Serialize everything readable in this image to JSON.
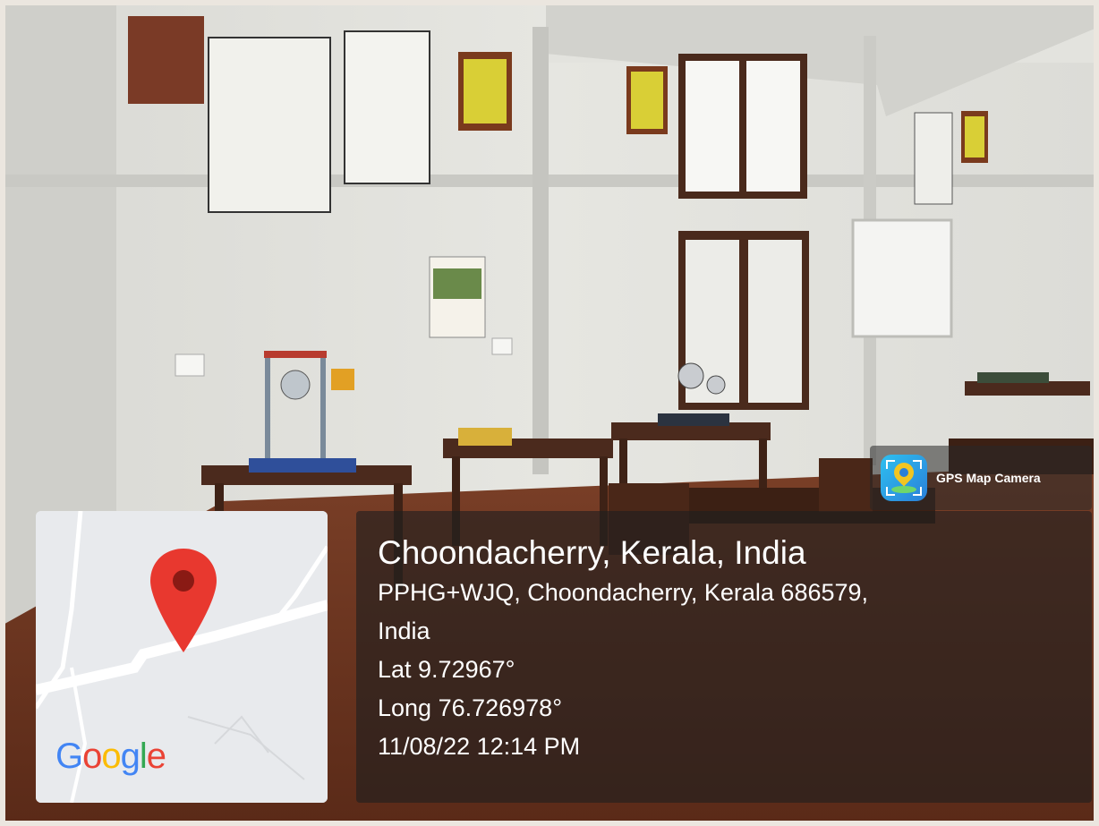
{
  "overlay": {
    "app_name": "GPS Map Camera",
    "app_icon": "gps-map-camera-icon",
    "place_title": "Choondacherry, Kerala, India",
    "address_line1": "PPHG+WJQ, Choondacherry, Kerala 686579,",
    "address_line2": "India",
    "latitude": "Lat 9.72967°",
    "longitude": "Long 76.726978°",
    "datetime": "11/08/22 12:14 PM",
    "map": {
      "logo_text": "Google",
      "marker_icon": "map-pin-icon",
      "marker_color": "#e8382f"
    }
  }
}
